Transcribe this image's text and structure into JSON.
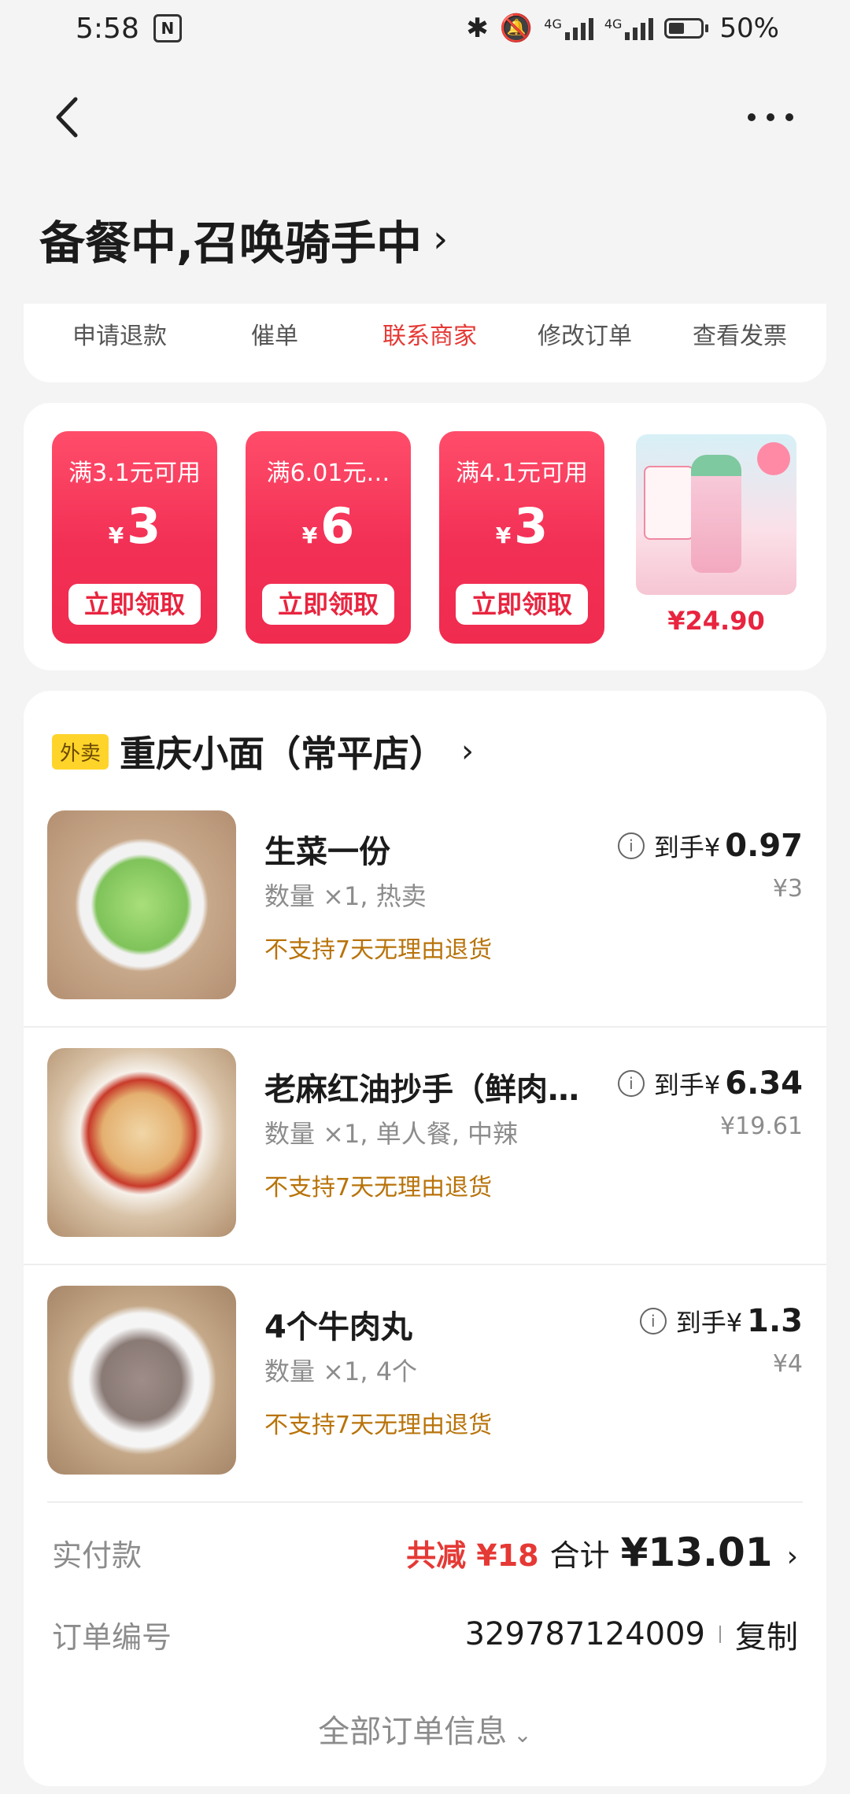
{
  "status_bar": {
    "time": "5:58",
    "nfc": "N",
    "battery": "50%",
    "net1": "4G",
    "net2": "4G",
    "battery_level": 0.5
  },
  "header": {
    "title": "备餐中,召唤骑手中",
    "chevron": "›"
  },
  "actions": [
    "申请退款",
    "催单",
    "联系商家",
    "修改订单",
    "查看发票"
  ],
  "active_action": "联系商家",
  "coupons": [
    {
      "condition": "满3.1元可用",
      "amount": "3",
      "button": "立即领取"
    },
    {
      "condition": "满6.01元…",
      "amount": "6",
      "button": "立即领取"
    },
    {
      "condition": "满4.1元可用",
      "amount": "3",
      "button": "立即领取"
    }
  ],
  "currency_symbol": "¥",
  "product_ad": {
    "price": "¥24.90"
  },
  "shop": {
    "tag": "外卖",
    "name": "重庆小面（常平店）"
  },
  "items": [
    {
      "title": "生菜一份",
      "meta": "数量 ×1, 热卖",
      "note": "不支持7天无理由退货",
      "price_label": "到手¥",
      "price": "0.97",
      "orig": "¥3"
    },
    {
      "title": "老麻红油抄手（鲜肉…",
      "meta": "数量 ×1, 单人餐, 中辣",
      "note": "不支持7天无理由退货",
      "price_label": "到手¥",
      "price": "6.34",
      "orig": "¥19.61"
    },
    {
      "title": "4个牛肉丸",
      "meta": "数量 ×1, 4个",
      "note": "不支持7天无理由退货",
      "price_label": "到手¥",
      "price": "1.3",
      "orig": "¥4"
    }
  ],
  "payment": {
    "label": "实付款",
    "discount": "共减 ¥18",
    "total_label": "合计",
    "total": "¥13.01"
  },
  "order": {
    "label": "订单编号",
    "number": "329787124009",
    "copy": "复制"
  },
  "all_info": "全部订单信息",
  "colors": {
    "accent_red": "#e53935",
    "coupon_red": "#f22f55",
    "note_orange": "#b8730a",
    "tag_yellow": "#ffd42a"
  }
}
